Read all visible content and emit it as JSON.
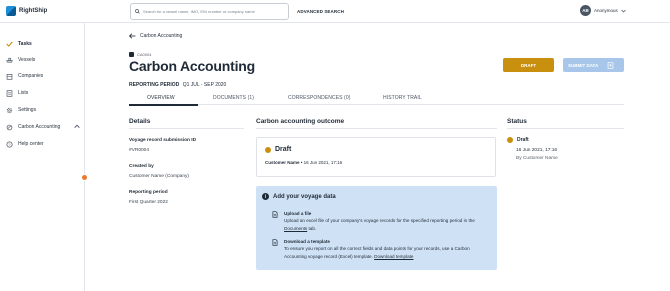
{
  "app": {
    "logo_text": "RightShip"
  },
  "search": {
    "placeholder": "Search for a vessel name, IMO, EIN number or company name"
  },
  "header": {
    "advanced_search": "ADVANCED SEARCH",
    "user_initials": "AB",
    "user_name": "Anonymous"
  },
  "sidebar": {
    "items": [
      {
        "label": "Tasks",
        "icon": "check-icon"
      },
      {
        "label": "Vessels",
        "icon": "ship-icon"
      },
      {
        "label": "Companies",
        "icon": "building-icon"
      },
      {
        "label": "Lists",
        "icon": "list-icon"
      },
      {
        "label": "Settings",
        "icon": "gear-icon"
      },
      {
        "label": "Carbon Accounting",
        "icon": "leaf-icon"
      },
      {
        "label": "Help center",
        "icon": "help-icon"
      }
    ]
  },
  "page": {
    "back_label": "Carbon Accounting",
    "case_id": "CA0004",
    "title": "Carbon Accounting",
    "period_label": "REPORTING PERIOD",
    "period_value": "Q1 JUL - SEP 2020",
    "draft_button": "DRAFT",
    "submit_button": "SUBMIT DATA"
  },
  "tabs": [
    "OVERVIEW",
    "DOCUMENTS (1)",
    "CORRESPONDENCES (0)",
    "HISTORY TRAIL"
  ],
  "details": {
    "heading": "Details",
    "fields": [
      {
        "label": "Voyage record submission ID",
        "value": "#VR0004"
      },
      {
        "label": "Created by",
        "value": "Customer Name (Company)"
      },
      {
        "label": "Reporting period",
        "value": "First Quarter 2022"
      }
    ]
  },
  "outcome": {
    "heading": "Carbon accounting outcome",
    "status": "Draft",
    "author": "Customer Name",
    "date": " • 16 Jun 2021, 17:16"
  },
  "info": {
    "heading": "Add your voyage data",
    "upload_title": "Upload a file",
    "upload_desc": "Upload an excel file of your company's voyage records for the specified reporting period in the ",
    "upload_link": "Documents",
    "upload_tail": " tab.",
    "template_title": "Download a template",
    "template_desc": "To ensure you report on all the correct fields and data points for your records, use a Carbon Accounting voyage record (Excel) template. ",
    "template_link": "Download template"
  },
  "status": {
    "heading": "Status",
    "state": "Draft",
    "date": "16 Jun 2021, 17:16",
    "by": "By Customer Name"
  },
  "colors": {
    "accent": "#c9900f",
    "submit": "#a7c6ea",
    "info_bg": "#cfe2f5",
    "alert": "#ea7a2e"
  }
}
